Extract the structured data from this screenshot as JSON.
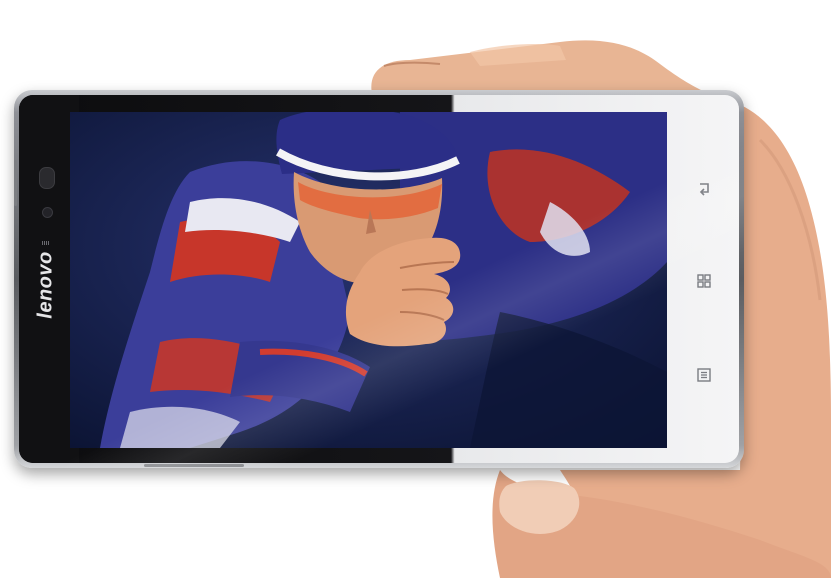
{
  "device": {
    "brand": "lenovo",
    "softkeys": [
      {
        "icon": "back-arrow-icon"
      },
      {
        "icon": "home-grid-icon"
      },
      {
        "icon": "menu-list-icon"
      }
    ]
  },
  "colors": {
    "skin": "#e7b08f",
    "suit_blue": "#3a3f9a",
    "suit_red": "#c8362a",
    "screen_bg": "#101a3a",
    "bezel": "#111113",
    "frame": "#f3f3f4"
  }
}
